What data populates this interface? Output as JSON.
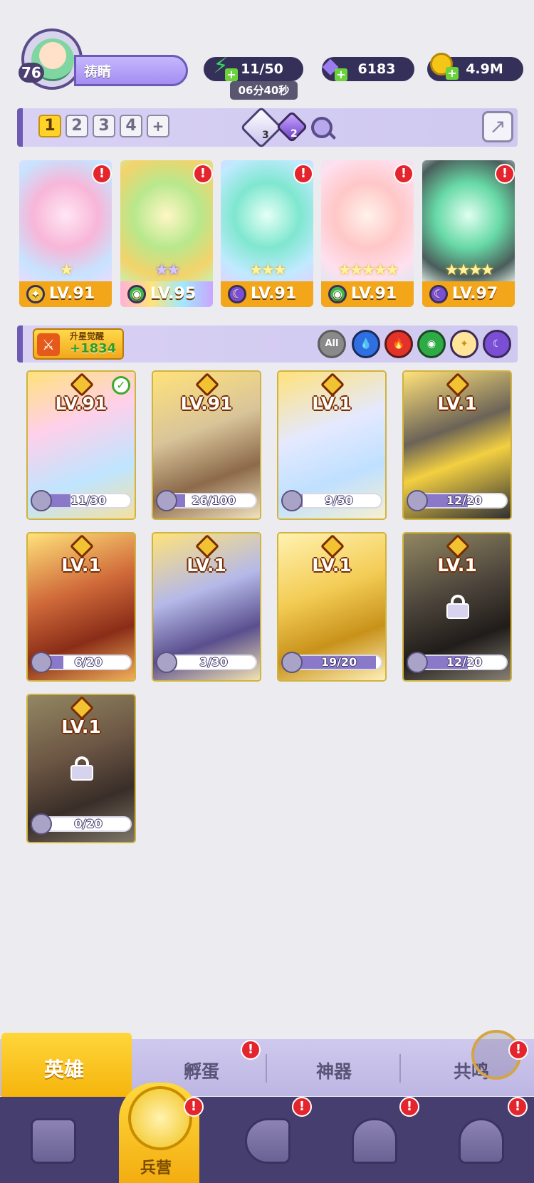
{
  "player": {
    "level": "76",
    "name": "祷睛"
  },
  "resources": {
    "energy": "11/50",
    "energy_timer": "06分40秒",
    "gems": "6183",
    "gold": "4.9M"
  },
  "team_tabs": [
    "1",
    "2",
    "3",
    "4",
    "+"
  ],
  "team_chips": [
    {
      "icon": "star-diamond-icon",
      "count": "3"
    },
    {
      "icon": "moon-diamond-icon",
      "count": "2"
    }
  ],
  "team": [
    {
      "level": "LV.91",
      "element": "star",
      "stars": "★",
      "star_style": "gold",
      "alert": true
    },
    {
      "level": "LV.95",
      "element": "nature",
      "stars": "★★",
      "star_style": "purple",
      "alert": true
    },
    {
      "level": "LV.91",
      "element": "moon",
      "stars": "★★★",
      "star_style": "gold",
      "alert": true
    },
    {
      "level": "LV.91",
      "element": "nature",
      "stars": "★★★★★",
      "star_style": "gold",
      "alert": true
    },
    {
      "level": "LV.97",
      "element": "moon",
      "stars": "★★★★",
      "star_style": "gold",
      "alert": true
    }
  ],
  "awaken": {
    "title": "升星觉醒",
    "value": "+1834"
  },
  "filters": [
    "All",
    "water",
    "fire",
    "nature",
    "star",
    "moon"
  ],
  "heroes": [
    {
      "level": "LV.91",
      "progress": "11/30",
      "fraction": 0.37,
      "owned": true,
      "checked": true
    },
    {
      "level": "LV.91",
      "progress": "26/100",
      "fraction": 0.26,
      "owned": true,
      "checked": false
    },
    {
      "level": "LV.1",
      "progress": "9/50",
      "fraction": 0.18,
      "owned": true,
      "checked": false
    },
    {
      "level": "LV.1",
      "progress": "12/20",
      "fraction": 0.6,
      "owned": true,
      "checked": false
    },
    {
      "level": "LV.1",
      "progress": "6/20",
      "fraction": 0.3,
      "owned": true,
      "checked": false
    },
    {
      "level": "LV.1",
      "progress": "3/30",
      "fraction": 0.1,
      "owned": true,
      "checked": false
    },
    {
      "level": "LV.1",
      "progress": "19/20",
      "fraction": 0.95,
      "owned": true,
      "checked": false
    },
    {
      "level": "LV.1",
      "progress": "12/20",
      "fraction": 0.6,
      "owned": false,
      "checked": false
    },
    {
      "level": "LV.1",
      "progress": "0/20",
      "fraction": 0.0,
      "owned": false,
      "checked": false
    }
  ],
  "subtabs": [
    {
      "label": "英雄",
      "active": true,
      "alert": false
    },
    {
      "label": "孵蛋",
      "active": false,
      "alert": true
    },
    {
      "label": "神器",
      "active": false,
      "alert": false
    },
    {
      "label": "共鸣",
      "active": false,
      "alert": true
    }
  ],
  "nav": [
    {
      "icon": "cards-icon",
      "label": "",
      "active": false,
      "alert": false
    },
    {
      "icon": "barracks-icon",
      "label": "兵营",
      "active": true,
      "alert": true
    },
    {
      "icon": "map-icon",
      "label": "",
      "active": false,
      "alert": true
    },
    {
      "icon": "shrine-icon",
      "label": "",
      "active": false,
      "alert": true
    },
    {
      "icon": "mushroom-house-icon",
      "label": "",
      "active": false,
      "alert": true
    }
  ],
  "alert_glyph": "!",
  "colors": {
    "accent_purple": "#6c5ab3",
    "gold": "#f3a619",
    "alert_red": "#e4252d",
    "nav_bg": "#463e6e"
  }
}
